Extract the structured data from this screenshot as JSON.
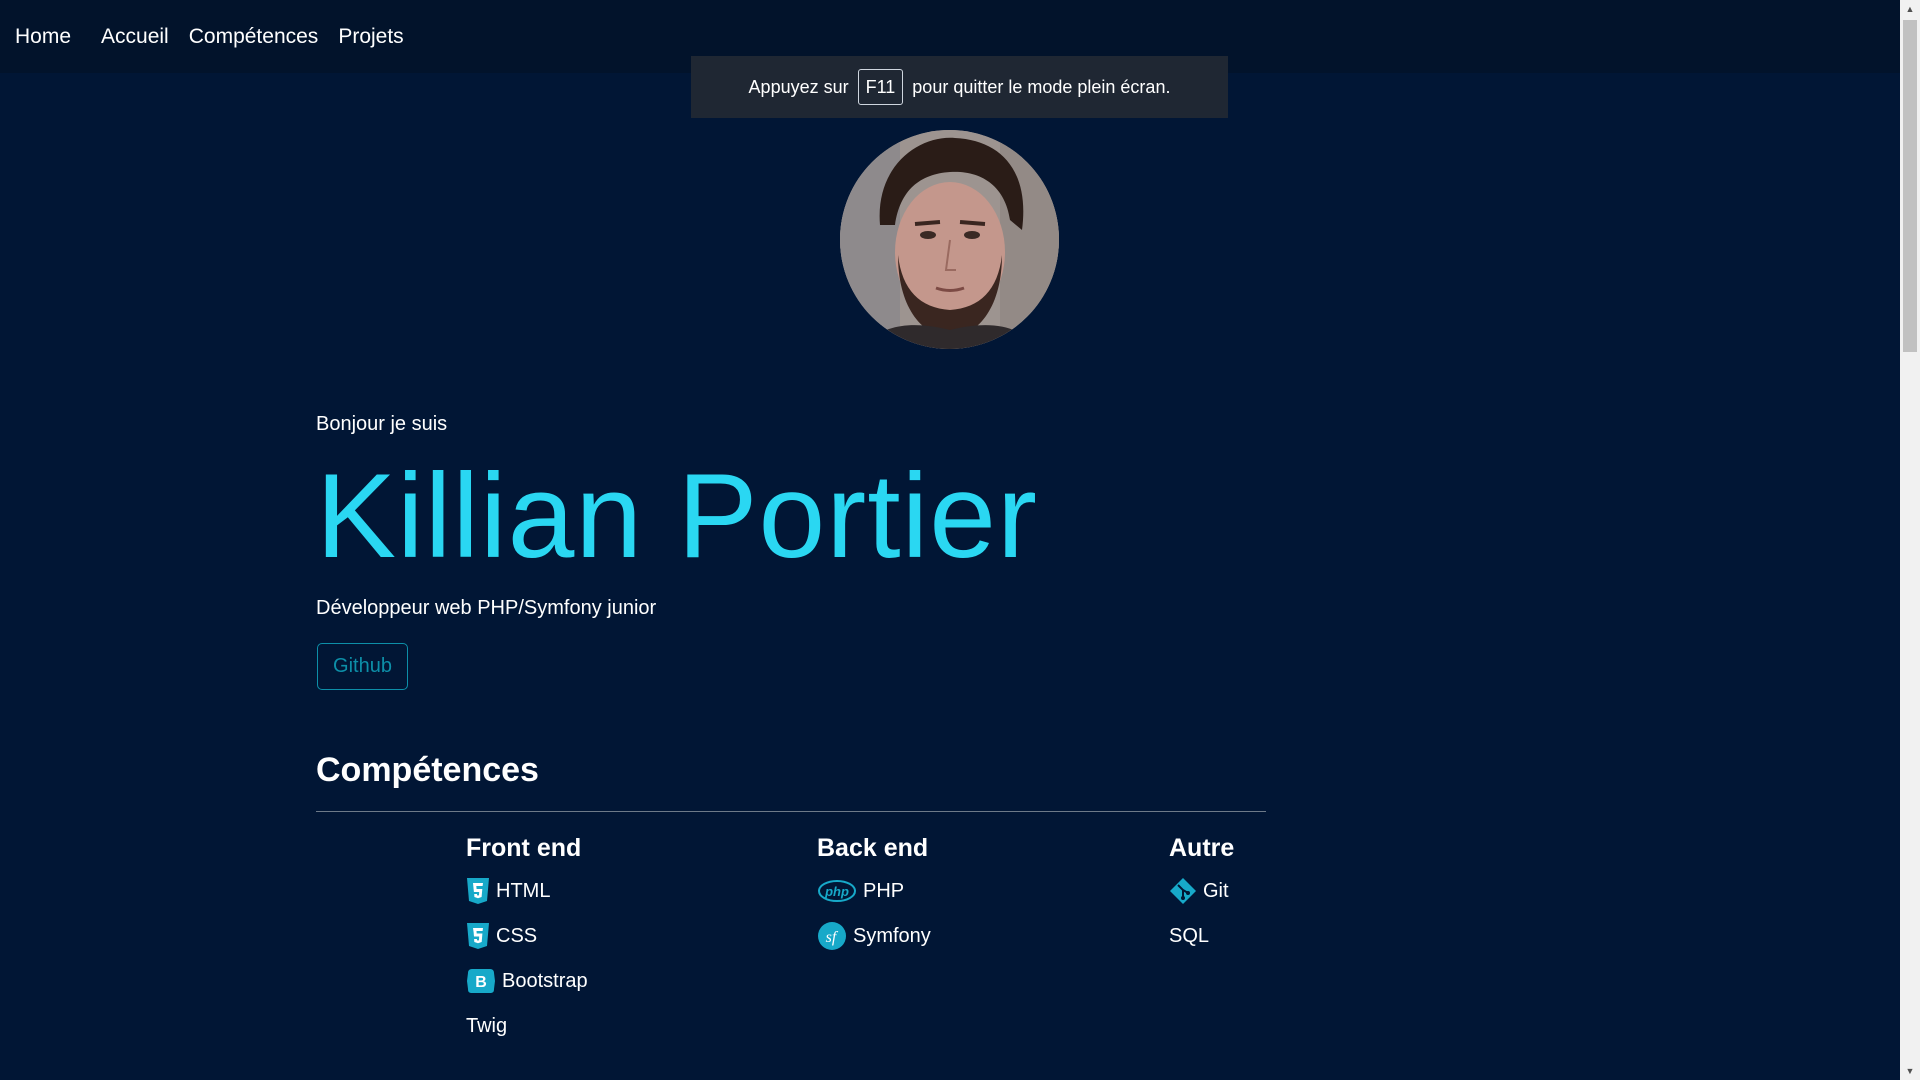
{
  "nav": {
    "brand": "Home",
    "links": [
      "Accueil",
      "Compétences",
      "Projets"
    ]
  },
  "fullscreen_toast": {
    "before": "Appuyez sur",
    "key": "F11",
    "after": "pour quitter le mode plein écran."
  },
  "hero": {
    "intro": "Bonjour je suis",
    "name": "Killian Portier",
    "role": "Développeur web PHP/Symfony junior",
    "github_label": "Github"
  },
  "skills": {
    "title": "Compétences",
    "columns": [
      {
        "title": "Front end",
        "items": [
          {
            "label": "HTML",
            "icon": "html5-icon"
          },
          {
            "label": "CSS",
            "icon": "css3-icon"
          },
          {
            "label": "Bootstrap",
            "icon": "bootstrap-icon"
          },
          {
            "label": "Twig",
            "icon": ""
          }
        ]
      },
      {
        "title": "Back end",
        "items": [
          {
            "label": "PHP",
            "icon": "php-icon"
          },
          {
            "label": "Symfony",
            "icon": "symfony-icon"
          }
        ]
      },
      {
        "title": "Autre",
        "items": [
          {
            "label": "Git",
            "icon": "git-icon"
          },
          {
            "label": "SQL",
            "icon": ""
          }
        ]
      }
    ]
  },
  "colors": {
    "background": "#011635",
    "navbar": "#02132b",
    "accent": "#2ad7f2",
    "button_outline": "#0d8fa8",
    "icon": "#17a9c9"
  }
}
